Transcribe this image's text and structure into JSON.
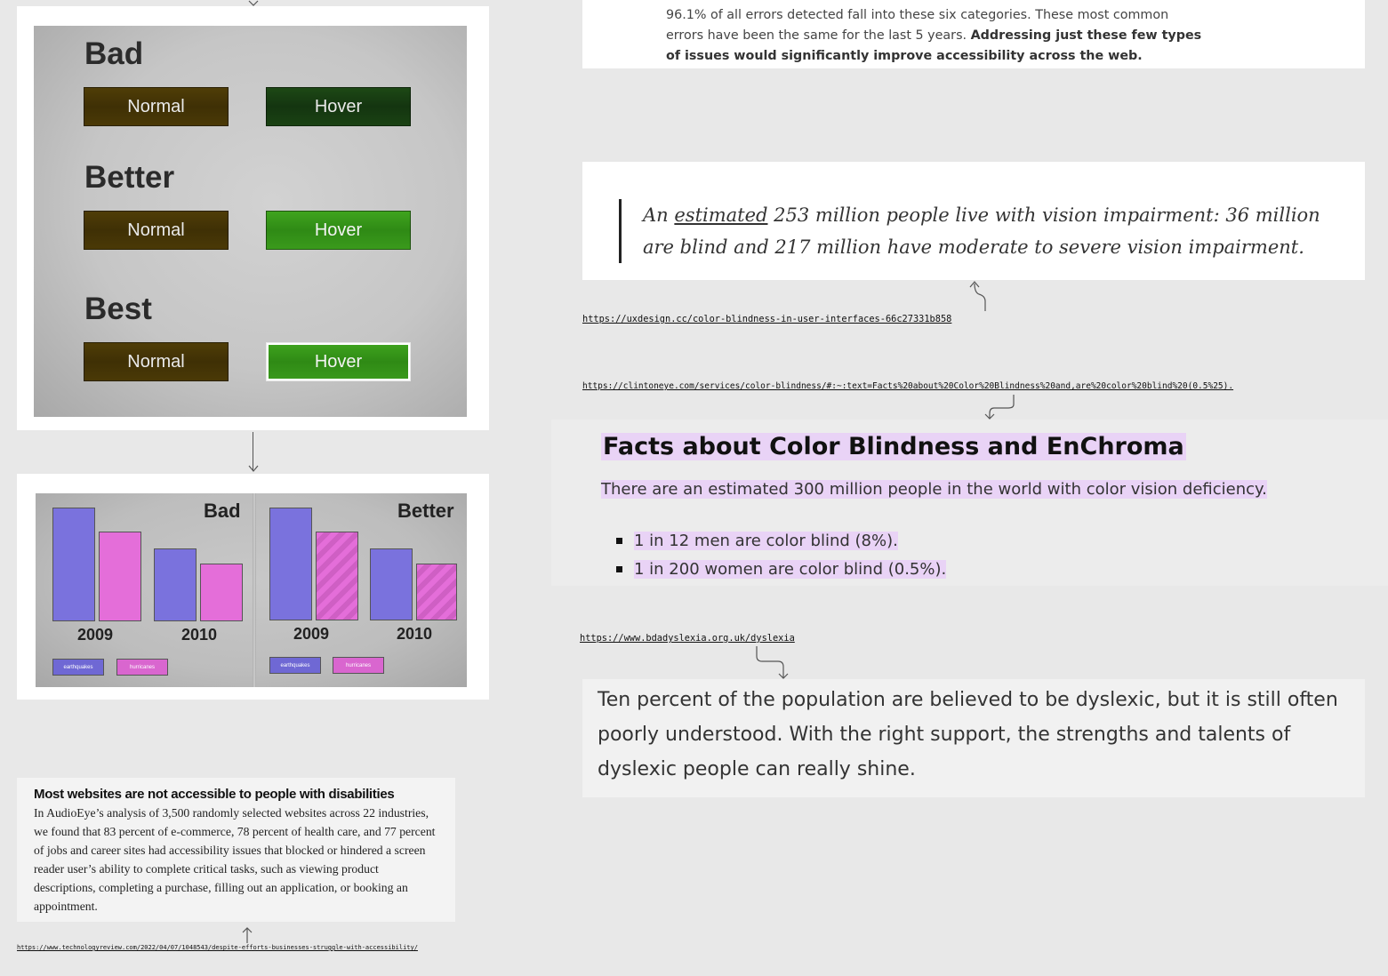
{
  "button_demo": {
    "sections": [
      {
        "heading": "Bad",
        "normal_label": "Normal",
        "hover_label": "Hover"
      },
      {
        "heading": "Better",
        "normal_label": "Normal",
        "hover_label": "Hover"
      },
      {
        "heading": "Best",
        "normal_label": "Normal",
        "hover_label": "Hover"
      }
    ],
    "colors": {
      "normal": "#4a3906",
      "hover_bad": "#173d11",
      "hover_good": "#36931a"
    }
  },
  "chart_demo": {
    "panels": [
      {
        "label": "Bad",
        "years": [
          "2009",
          "2010"
        ],
        "legend": [
          "earthquakes",
          "hurricanes"
        ]
      },
      {
        "label": "Better",
        "years": [
          "2009",
          "2010"
        ],
        "legend": [
          "earthquakes",
          "hurricanes"
        ]
      }
    ],
    "colors": {
      "earthquakes": "#7a72dd",
      "hurricanes": "#e46ed9"
    }
  },
  "chart_data": [
    {
      "type": "bar",
      "title": "Bad",
      "categories": [
        "2009",
        "2010"
      ],
      "series": [
        {
          "name": "earthquakes",
          "values": [
            100,
            64
          ]
        },
        {
          "name": "hurricanes",
          "values": [
            78,
            51
          ]
        }
      ]
    },
    {
      "type": "bar",
      "title": "Better",
      "categories": [
        "2009",
        "2010"
      ],
      "series": [
        {
          "name": "earthquakes",
          "values": [
            100,
            64
          ]
        },
        {
          "name": "hurricanes",
          "values": [
            78,
            51
          ]
        }
      ]
    }
  ],
  "mit_card": {
    "title": "Most websites are not accessible to people with disabilities",
    "body": "In AudioEye’s analysis of 3,500 randomly selected websites across 22 industries, we found that 83 percent of e-commerce, 78 percent of health care, and 77 percent of jobs and career sites had accessibility issues that blocked or hindered a screen reader user’s ability to complete critical tasks, such as viewing product descriptions, completing a purchase, filling out an application, or booking an appointment.",
    "url": "https://www.technologyreview.com/2022/04/07/1048543/despite-efforts-businesses-struggle-with-accessibility/"
  },
  "webaim_card": {
    "line1": "96.1% of all errors detected fall into these six categories. These most common",
    "line2_plain": "errors have been the same for the last 5 years. ",
    "line2_bold": "Addressing just these few types",
    "line3_bold": "of issues would significantly improve accessibility across the web."
  },
  "vision_quote": {
    "prefix": "An ",
    "underlined": "estimated",
    "rest": " 253 million people live with vision impairment: 36 million are blind and 217 million have moderate to severe vision impairment.",
    "url": "https://uxdesign.cc/color-blindness-in-user-interfaces-66c27331b858"
  },
  "color_blindness": {
    "url": "https://clintoneye.com/services/color-blindness/#:~:text=Facts%20about%20Color%20Blindness%20and,are%20color%20blind%20(0.5%25).",
    "title": "Facts about Color Blindness and EnChroma",
    "subtitle": "There are an estimated 300 million people in the world with color vision deficiency.",
    "items": [
      "1 in 12 men are color blind (8%).",
      "1 in 200 women are color blind (0.5%)."
    ],
    "highlight_color": "#e9d3f6"
  },
  "dyslexia": {
    "url": "https://www.bdadyslexia.org.uk/dyslexia",
    "text": "Ten percent of the population are believed to be dyslexic, but it is still often poorly understood. With the right support, the strengths and talents of dyslexic people can really shine."
  },
  "icons": [
    "arrow-down-icon",
    "arrow-up-icon",
    "curved-arrow-icon"
  ]
}
